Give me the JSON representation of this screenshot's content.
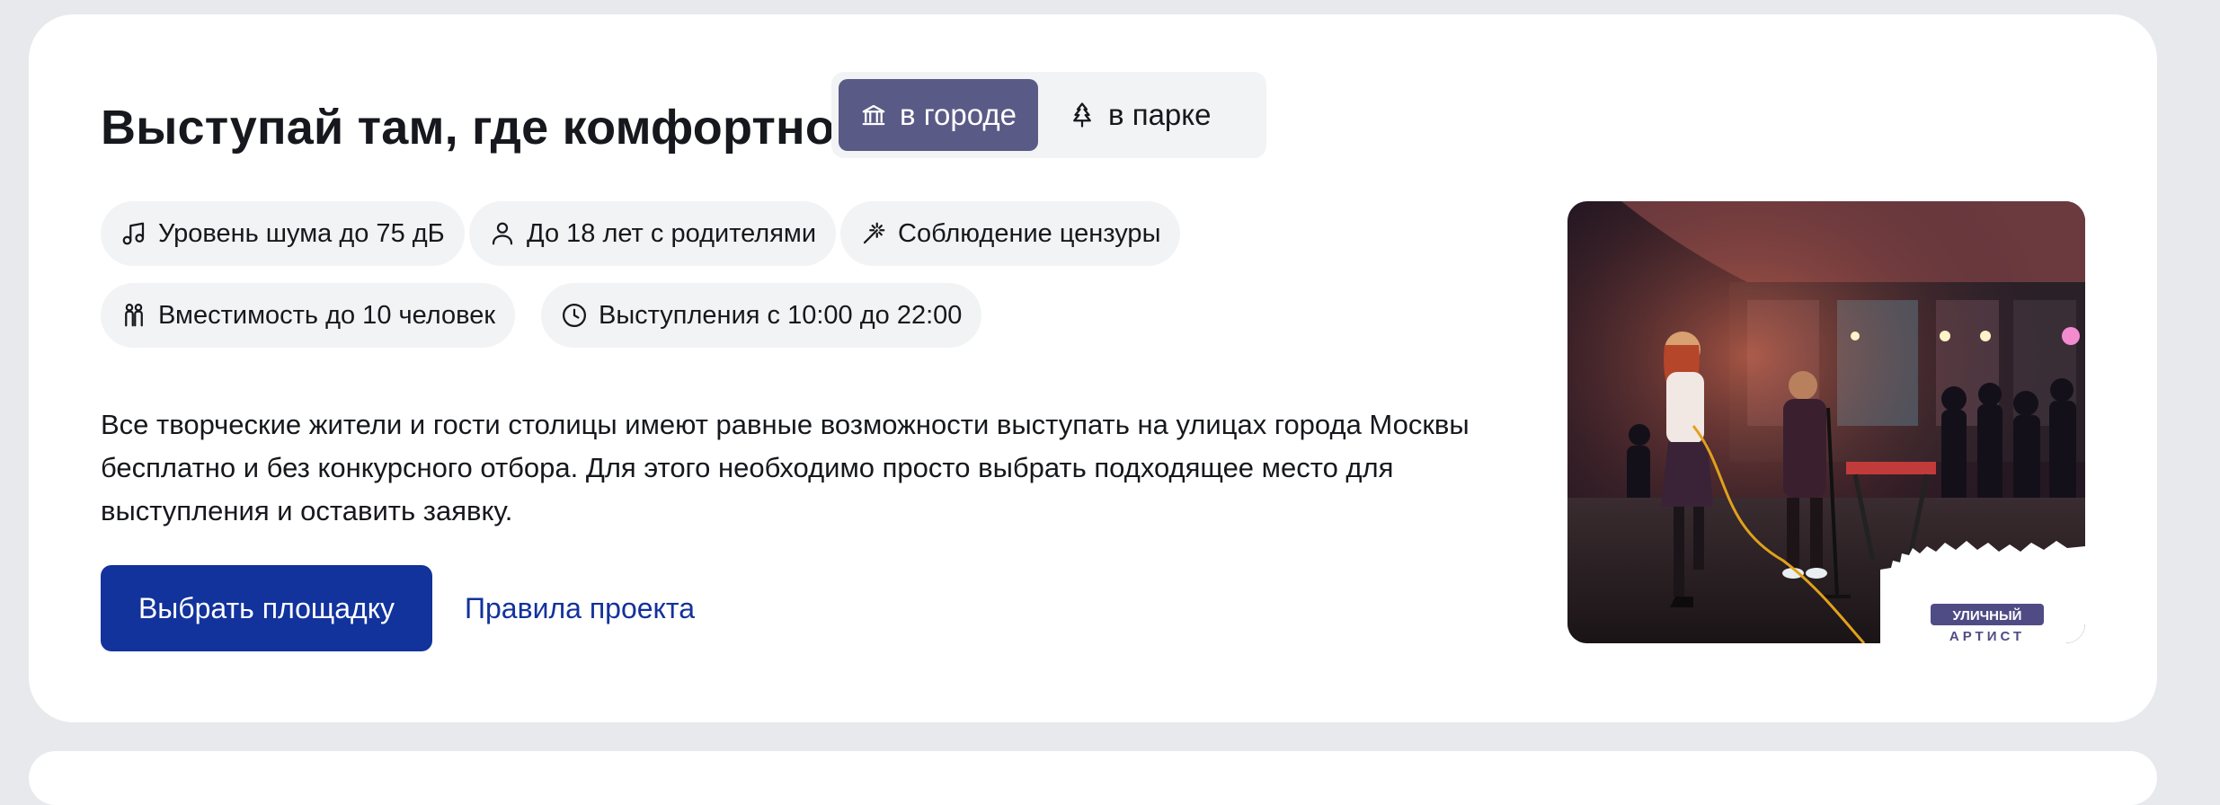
{
  "section": {
    "title": "Выступай там, где комфортно",
    "location_toggle": {
      "options": [
        {
          "label": "в городе",
          "icon": "museum-icon",
          "active": true
        },
        {
          "label": "в парке",
          "icon": "tree-icon",
          "active": false
        }
      ]
    },
    "features": [
      {
        "label": "Уровень шума до 75 дБ",
        "icon": "music-note-icon"
      },
      {
        "label": "До 18 лет с родителями",
        "icon": "person-icon"
      },
      {
        "label": "Соблюдение цензуры",
        "icon": "magic-wand-icon"
      },
      {
        "label": "Вместимость до 10 человек",
        "icon": "people-icon"
      },
      {
        "label": "Выступления с 10:00 до 22:00",
        "icon": "clock-icon"
      }
    ],
    "description": "Все творческие жители и гости столицы имеют равные возможности выступать на улицах города Москвы бесплатно и без конкурсного отбора. Для этого необходимо просто выбрать подходящее место для выступления и оставить заявку.",
    "primary_button": "Выбрать площадку",
    "rules_link": "Правила проекта",
    "photo": {
      "logo_line1": "УЛИЧНЫЙ",
      "logo_line2": "АРТИСТ"
    }
  },
  "colors": {
    "page_bg": "#e7e9ec",
    "card_bg": "#ffffff",
    "chip_bg": "#f2f3f5",
    "toggle_active": "#5a5a86",
    "primary": "#12329c",
    "text": "#16181d"
  }
}
